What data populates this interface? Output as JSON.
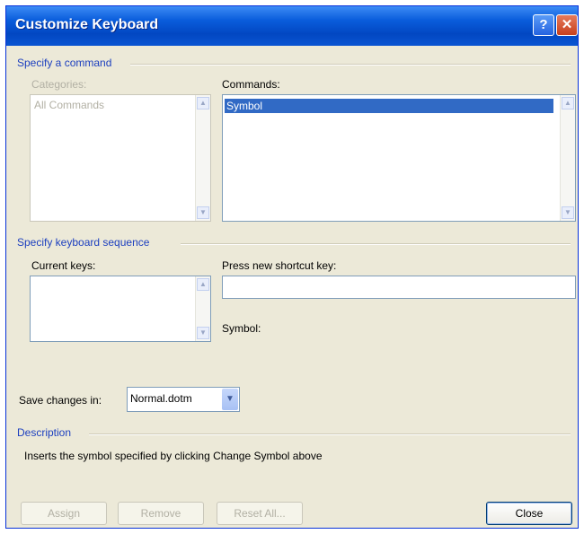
{
  "window": {
    "title": "Customize Keyboard",
    "help_glyph": "?",
    "close_glyph": "✕"
  },
  "specify_command": {
    "group_label": "Specify a command",
    "categories_label": "Categories:",
    "categories": [
      "All Commands"
    ],
    "commands_label": "Commands:",
    "commands": [
      "Symbol"
    ]
  },
  "keyboard_sequence": {
    "group_label": "Specify keyboard sequence",
    "current_keys_label": "Current keys:",
    "press_new_label": "Press new shortcut key:",
    "new_shortcut_value": "",
    "command_name": "Symbol:"
  },
  "save_changes": {
    "label": "Save changes in:",
    "value": "Normal.dotm"
  },
  "description": {
    "group_label": "Description",
    "text": "Inserts the symbol specified by clicking Change Symbol above"
  },
  "buttons": {
    "assign": "Assign",
    "remove": "Remove",
    "reset_all": "Reset All...",
    "close": "Close"
  },
  "icons": {
    "scroll_up": "▲",
    "scroll_down": "▼",
    "dropdown": "▼"
  }
}
